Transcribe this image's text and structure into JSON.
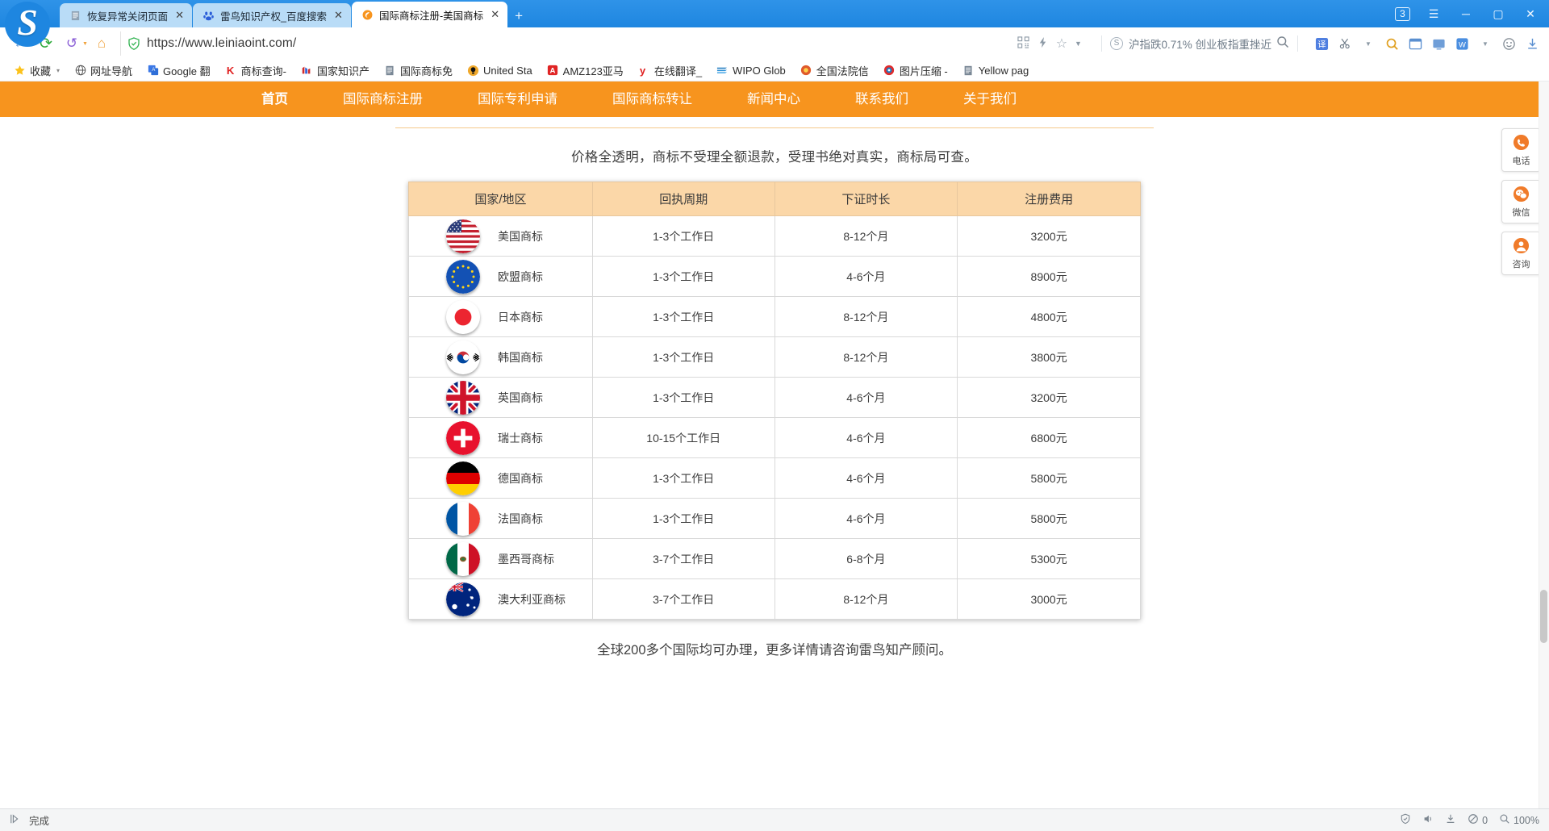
{
  "browser": {
    "tabs": [
      {
        "title": "恢复异常关闭页面",
        "icon": "document-icon",
        "active": false
      },
      {
        "title": "雷鸟知识产权_百度搜索",
        "icon": "baidu-icon",
        "active": false
      },
      {
        "title": "国际商标注册-美国商标",
        "icon": "site-icon",
        "active": true
      }
    ],
    "new_tab_label": "+",
    "window": {
      "tab_count_badge": "3",
      "menu": "☰",
      "minimize": "─",
      "maximize": "▢",
      "close": "✕"
    },
    "toolbar": {
      "back": "←",
      "reload": "⟳",
      "history_back": "↺",
      "home": "⌂",
      "url": "https://www.leiniaoint.com/",
      "security_label": "shield-icon",
      "apps": "apps-icon",
      "speed": "lightning-icon",
      "bookmark_star": "star-icon",
      "dropdown": "▾",
      "ticker": "沪指跌0.71% 创业板指重挫近",
      "search": "search-icon",
      "extensions": [
        "translate-icon",
        "scissors-icon",
        "magnifier-icon",
        "window-icon",
        "screen-icon",
        "wps-icon",
        "emoji-icon",
        "download-icon"
      ]
    },
    "bookmarks": [
      {
        "label": "收藏",
        "icon": "star-icon",
        "caret": "▾"
      },
      {
        "label": "网址导航",
        "icon": "globe-icon"
      },
      {
        "label": "Google 翻",
        "icon": "google-translate-icon"
      },
      {
        "label": "商标查询-",
        "icon": "k-icon"
      },
      {
        "label": "国家知识产",
        "icon": "cnipa-icon"
      },
      {
        "label": "国际商标免",
        "icon": "document-icon"
      },
      {
        "label": "United Sta",
        "icon": "uspto-icon"
      },
      {
        "label": "AMZ123亚马",
        "icon": "amz-icon"
      },
      {
        "label": "在线翻译_",
        "icon": "youdao-icon"
      },
      {
        "label": "WIPO Glob",
        "icon": "wipo-icon"
      },
      {
        "label": "全国法院信",
        "icon": "court-icon"
      },
      {
        "label": "图片压缩 -",
        "icon": "image-compress-icon"
      },
      {
        "label": "Yellow pag",
        "icon": "document-icon"
      }
    ],
    "statusbar": {
      "left_icon": "navigate-icon",
      "status_text": "完成",
      "shield": "shield-icon",
      "sound": "sound-icon",
      "download": "download-icon",
      "block_icon": "block-icon",
      "block_count": "0",
      "zoom_icon": "zoom-icon",
      "zoom_level": "100%"
    }
  },
  "site": {
    "nav": [
      {
        "label": "首页",
        "active": true
      },
      {
        "label": "国际商标注册",
        "active": false
      },
      {
        "label": "国际专利申请",
        "active": false
      },
      {
        "label": "国际商标转让",
        "active": false
      },
      {
        "label": "新闻中心",
        "active": false
      },
      {
        "label": "联系我们",
        "active": false
      },
      {
        "label": "关于我们",
        "active": false
      }
    ],
    "subtitle": "价格全透明，商标不受理全额退款，受理书绝对真实，商标局可查。",
    "footnote": "全球200多个国际均可办理，更多详情请咨询雷鸟知产顾问。",
    "table": {
      "headers": [
        "国家/地区",
        "回执周期",
        "下证时长",
        "注册费用"
      ],
      "rows": [
        {
          "flag": "us-flag-icon",
          "country": "美国商标",
          "receipt": "1-3个工作日",
          "duration": "8-12个月",
          "fee": "3200元"
        },
        {
          "flag": "eu-flag-icon",
          "country": "欧盟商标",
          "receipt": "1-3个工作日",
          "duration": "4-6个月",
          "fee": "8900元"
        },
        {
          "flag": "jp-flag-icon",
          "country": "日本商标",
          "receipt": "1-3个工作日",
          "duration": "8-12个月",
          "fee": "4800元"
        },
        {
          "flag": "kr-flag-icon",
          "country": "韩国商标",
          "receipt": "1-3个工作日",
          "duration": "8-12个月",
          "fee": "3800元"
        },
        {
          "flag": "gb-flag-icon",
          "country": "英国商标",
          "receipt": "1-3个工作日",
          "duration": "4-6个月",
          "fee": "3200元"
        },
        {
          "flag": "ch-flag-icon",
          "country": "瑞士商标",
          "receipt": "10-15个工作日",
          "duration": "4-6个月",
          "fee": "6800元"
        },
        {
          "flag": "de-flag-icon",
          "country": "德国商标",
          "receipt": "1-3个工作日",
          "duration": "4-6个月",
          "fee": "5800元"
        },
        {
          "flag": "fr-flag-icon",
          "country": "法国商标",
          "receipt": "1-3个工作日",
          "duration": "4-6个月",
          "fee": "5800元"
        },
        {
          "flag": "mx-flag-icon",
          "country": "墨西哥商标",
          "receipt": "3-7个工作日",
          "duration": "6-8个月",
          "fee": "5300元"
        },
        {
          "flag": "au-flag-icon",
          "country": "澳大利亚商标",
          "receipt": "3-7个工作日",
          "duration": "8-12个月",
          "fee": "3000元"
        }
      ]
    },
    "side_widgets": [
      {
        "label": "电话",
        "icon": "phone-icon"
      },
      {
        "label": "微信",
        "icon": "wechat-icon"
      },
      {
        "label": "咨询",
        "icon": "consult-icon"
      }
    ]
  },
  "colors": {
    "brand_orange": "#f7941e",
    "header_cell": "#fbd7a8",
    "tab_blue": "#1e86e0"
  }
}
